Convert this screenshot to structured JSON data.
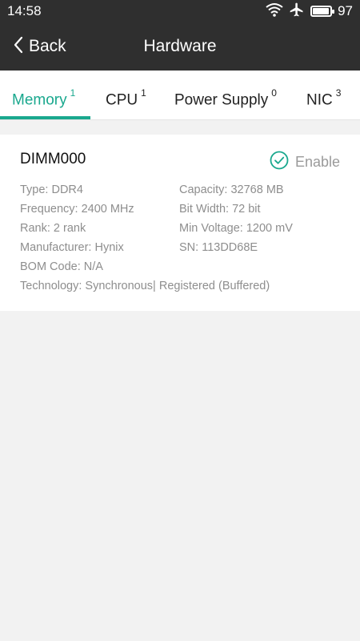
{
  "status_bar": {
    "time": "14:58",
    "battery_percent": "97",
    "battery_level": 0.97,
    "icons": [
      "wifi-icon",
      "airplane-mode-icon",
      "battery-icon"
    ]
  },
  "app_bar": {
    "back_label": "Back",
    "title": "Hardware"
  },
  "tabs": [
    {
      "label": "Memory",
      "count": "1",
      "active": true
    },
    {
      "label": "CPU",
      "count": "1",
      "active": false
    },
    {
      "label": "Power Supply",
      "count": "0",
      "active": false
    },
    {
      "label": "NIC",
      "count": "3",
      "active": false
    }
  ],
  "colors": {
    "accent": "#1aa88e",
    "header_bg": "#2f2f2f",
    "page_bg": "#f2f2f2"
  },
  "memory_card": {
    "name": "DIMM000",
    "status": "Enable",
    "status_icon": "check-circle-icon",
    "type": "Type: DDR4",
    "capacity": "Capacity: 32768 MB",
    "frequency": "Frequency: 2400 MHz",
    "bit_width": "Bit Width: 72 bit",
    "rank": "Rank: 2 rank",
    "min_voltage": "Min Voltage: 1200 mV",
    "manufacturer": "Manufacturer: Hynix",
    "sn": "SN: 113DD68E",
    "bom_code": "BOM Code: N/A",
    "technology": "Technology: Synchronous| Registered (Buffered)"
  }
}
